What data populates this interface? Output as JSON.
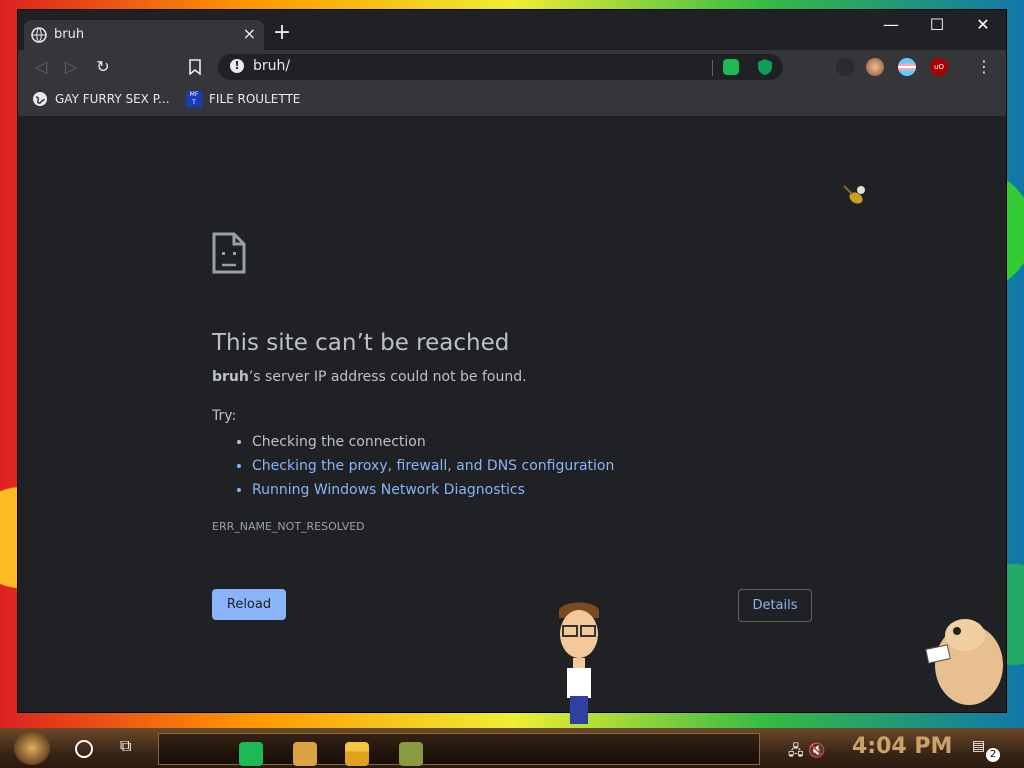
{
  "tab": {
    "title": "bruh",
    "close": "×",
    "new": "+"
  },
  "window_controls": {
    "minimize": "—",
    "maximize": "☐",
    "close": "✕"
  },
  "toolbar": {
    "back": "◁",
    "forward": "▷",
    "reload": "↻",
    "menu": "⋮"
  },
  "omnibox": {
    "url": "bruh/"
  },
  "bookmarks": [
    {
      "label": "GAY FURRY SEX P..."
    },
    {
      "label": "FILE ROULETTE"
    }
  ],
  "error": {
    "heading": "This site can’t be reached",
    "host": "bruh",
    "message_suffix": "’s server IP address could not be found.",
    "try_label": "Try:",
    "suggestions": [
      "Checking the connection",
      "Checking the proxy, firewall, and DNS configuration",
      "Running Windows Network Diagnostics"
    ],
    "code": "ERR_NAME_NOT_RESOLVED",
    "reload_label": "Reload",
    "details_label": "Details"
  },
  "taskbar": {
    "clock": "4:04 PM",
    "notification_count": "2"
  },
  "colors": {
    "page_bg": "#202124",
    "text": "#bdc1c6",
    "link": "#8ab4f8",
    "reload_button": "#8ab4f8"
  }
}
